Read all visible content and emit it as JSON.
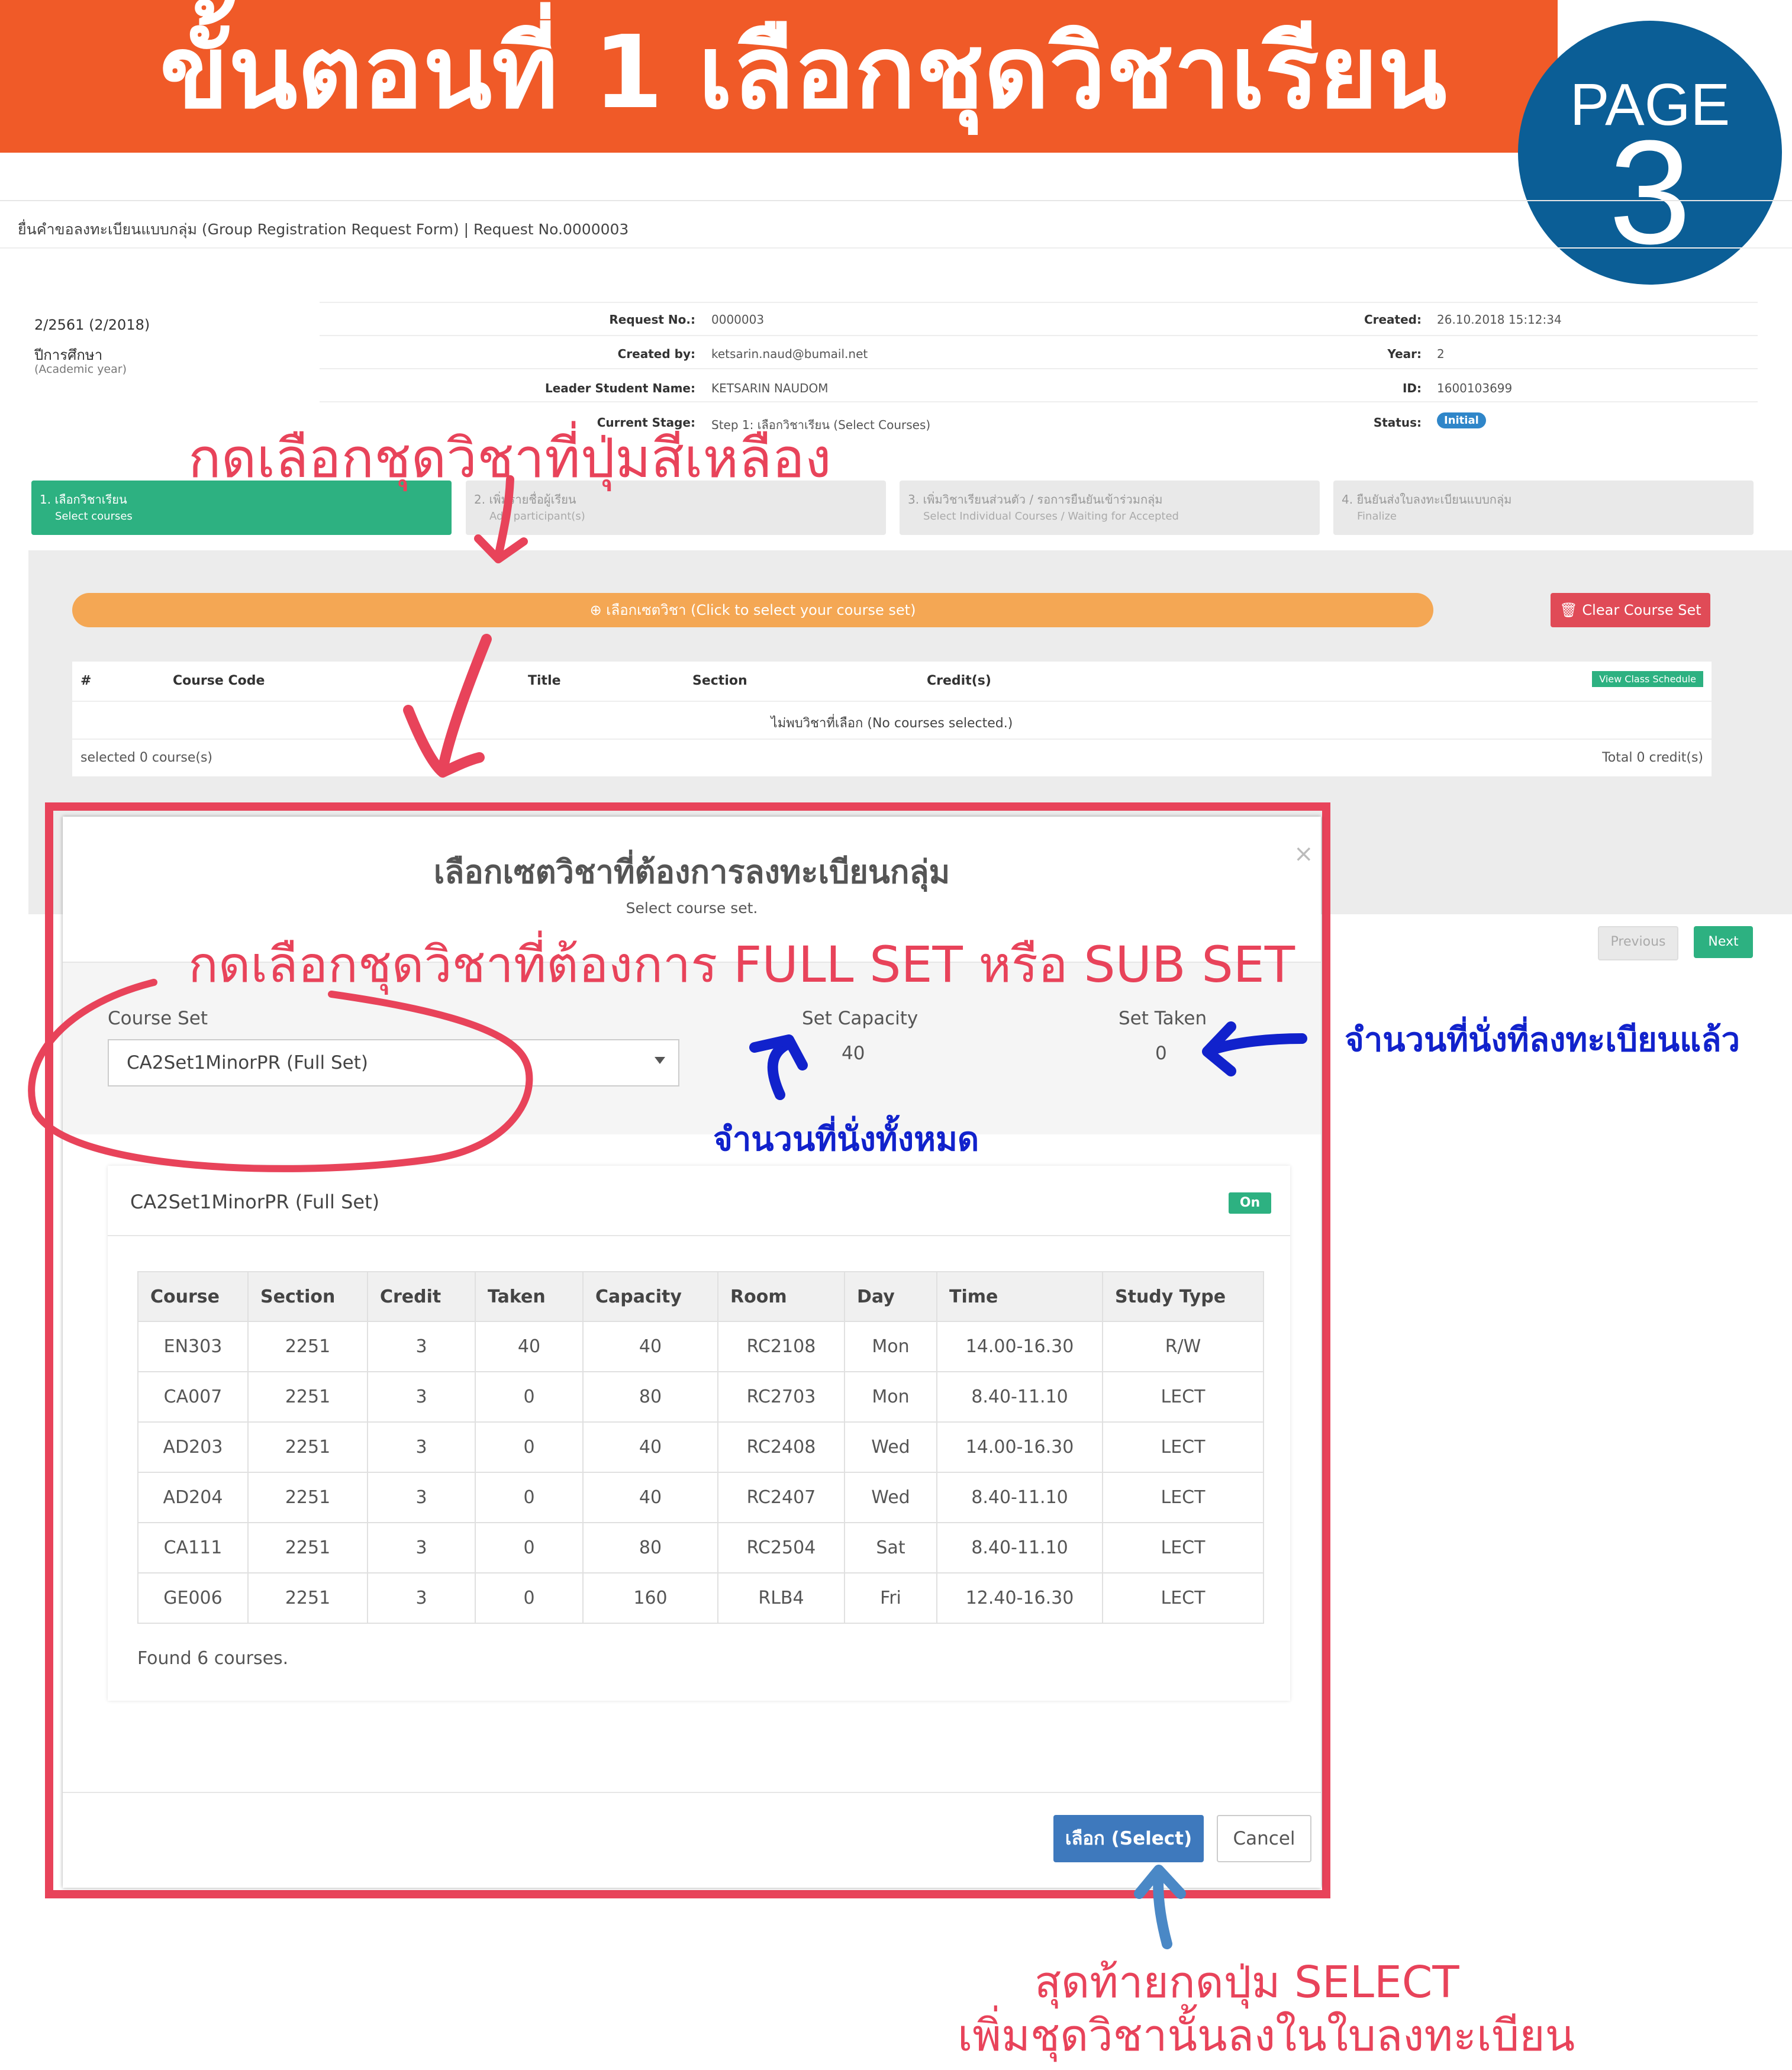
{
  "banner": {
    "title": "ขั้นตอนที่ 1 เลือกชุดวิชาเรียน",
    "page_word": "PAGE",
    "page_number": "3"
  },
  "app": {
    "breadcrumb": "ยื่นคำขอลงทะเบียนแบบกลุ่ม (Group Registration Request Form) | Request No.0000003",
    "academic_year": {
      "value": "2/2561 (2/2018)",
      "label": "ปีการศึกษา",
      "sublabel": "(Academic year)"
    },
    "info": {
      "request_no_label": "Request No.:",
      "request_no": "0000003",
      "created_label": "Created:",
      "created": "26.10.2018 15:12:34",
      "created_by_label": "Created by:",
      "created_by": "ketsarin.naud@bumail.net",
      "year_label": "Year:",
      "year": "2",
      "leader_label": "Leader Student Name:",
      "leader": "KETSARIN NAUDOM",
      "id_label": "ID:",
      "id": "1600103699",
      "stage_label": "Current Stage:",
      "stage": "Step 1: เลือกวิชาเรียน (Select Courses)",
      "status_label": "Status:",
      "status": "Initial"
    },
    "steps": [
      {
        "title": "1. เลือกวิชาเรียน",
        "subtitle": "Select courses"
      },
      {
        "title": "2. เพิ่มรายชื่อผู้เรียน",
        "subtitle": "Add participant(s)"
      },
      {
        "title": "3. เพิ่มวิชาเรียนส่วนตัว / รอการยืนยันเข้าร่วมกลุ่ม",
        "subtitle": "Select Individual Courses / Waiting for Accepted"
      },
      {
        "title": "4. ยืนยันส่งใบลงทะเบียนแบบกลุ่ม",
        "subtitle": "Finalize"
      }
    ],
    "select_set_button": "⊕ เลือกเซตวิชา (Click to select your course set)",
    "clear_button": "🗑 Clear Course Set",
    "course_table": {
      "headers": [
        "#",
        "Course Code",
        "Title",
        "Section",
        "Credit(s)"
      ],
      "view_schedule": "View Class Schedule",
      "empty_message": "ไม่พบวิชาที่เลือก (No courses selected.)",
      "selected_count": "selected 0 course(s)",
      "total_credit": "Total 0 credit(s)"
    },
    "previous_button": "Previous",
    "next_button": "Next"
  },
  "modal": {
    "title": "เลือกเซตวิชาที่ต้องการลงทะเบียนกลุ่ม",
    "subtitle": "Select course set.",
    "close": "×",
    "course_set_label": "Course Set",
    "course_set_value": "CA2Set1MinorPR (Full Set)",
    "set_capacity_label": "Set Capacity",
    "set_capacity_value": "40",
    "set_taken_label": "Set Taken",
    "set_taken_value": "0",
    "set_card_title": "CA2Set1MinorPR (Full Set)",
    "set_status": "On",
    "table_headers": [
      "Course",
      "Section",
      "Credit",
      "Taken",
      "Capacity",
      "Room",
      "Day",
      "Time",
      "Study Type"
    ],
    "rows": [
      [
        "EN303",
        "2251",
        "3",
        "40",
        "40",
        "RC2108",
        "Mon",
        "14.00-16.30",
        "R/W"
      ],
      [
        "CA007",
        "2251",
        "3",
        "0",
        "80",
        "RC2703",
        "Mon",
        "8.40-11.10",
        "LECT"
      ],
      [
        "AD203",
        "2251",
        "3",
        "0",
        "40",
        "RC2408",
        "Wed",
        "14.00-16.30",
        "LECT"
      ],
      [
        "AD204",
        "2251",
        "3",
        "0",
        "40",
        "RC2407",
        "Wed",
        "8.40-11.10",
        "LECT"
      ],
      [
        "CA111",
        "2251",
        "3",
        "0",
        "80",
        "RC2504",
        "Sat",
        "8.40-11.10",
        "LECT"
      ],
      [
        "GE006",
        "2251",
        "3",
        "0",
        "160",
        "RLB4",
        "Fri",
        "12.40-16.30",
        "LECT"
      ]
    ],
    "found_text": "Found 6 courses.",
    "select_button": "เลือก (Select)",
    "cancel_button": "Cancel"
  },
  "annotations": {
    "click_yellow": "กดเลือกชุดวิชาที่ปุ่มสีเหลือง",
    "choose_set": "กดเลือกชุดวิชาที่ต้องการ FULL SET หรือ SUB SET",
    "seats_taken": "จำนวนที่นั่งที่ลงทะเบียนแล้ว",
    "seats_total": "จำนวนที่นั่งทั้งหมด",
    "final_line1": "สุดท้ายกดปุ่ม SELECT",
    "final_line2": "เพิ่มชุดวิชานั้นลงในใบลงทะเบียน"
  },
  "colors": {
    "banner": "#f05a28",
    "badge": "#0b5e96",
    "annotation_red": "#e8435a",
    "annotation_blue": "#1122cc",
    "yellow_button": "#f4a754",
    "green": "#2db181",
    "select_blue": "#3e79bd"
  }
}
